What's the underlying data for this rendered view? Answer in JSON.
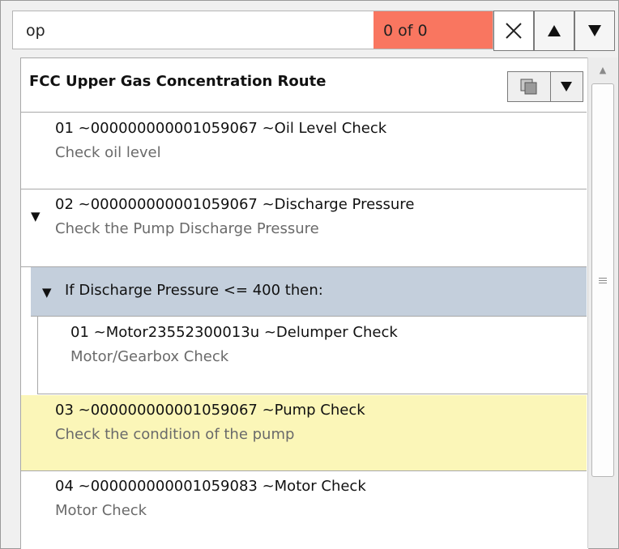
{
  "search": {
    "query": "op",
    "match_count": "0 of 0"
  },
  "route": {
    "title": "FCC Upper Gas Concentration Route"
  },
  "steps": [
    {
      "title": "01 ~000000000001059067 ~Oil Level Check",
      "desc": "Check oil level"
    },
    {
      "title": "02 ~000000000001059067 ~Discharge Pressure",
      "desc": "Check the Pump Discharge Pressure"
    },
    {
      "title": "03 ~000000000001059067 ~Pump Check",
      "desc": "Check the condition of the pump"
    },
    {
      "title": "04 ~000000000001059083 ~Motor Check",
      "desc": "Motor Check"
    }
  ],
  "condition": {
    "label": "If Discharge Pressure <= 400 then:",
    "child": {
      "title": "01 ~Motor23552300013u ~Delumper Check",
      "desc": "Motor/Gearbox Check"
    }
  },
  "colors": {
    "match_badge": "#f97660",
    "highlight_row": "#fbf6b8",
    "condition_row": "#c4cfdc"
  },
  "icons": [
    "close-icon",
    "arrow-up-icon",
    "arrow-down-icon",
    "copy-icon",
    "dropdown-icon",
    "caret-down-icon",
    "scroll-up-icon",
    "scroll-grip-icon"
  ]
}
